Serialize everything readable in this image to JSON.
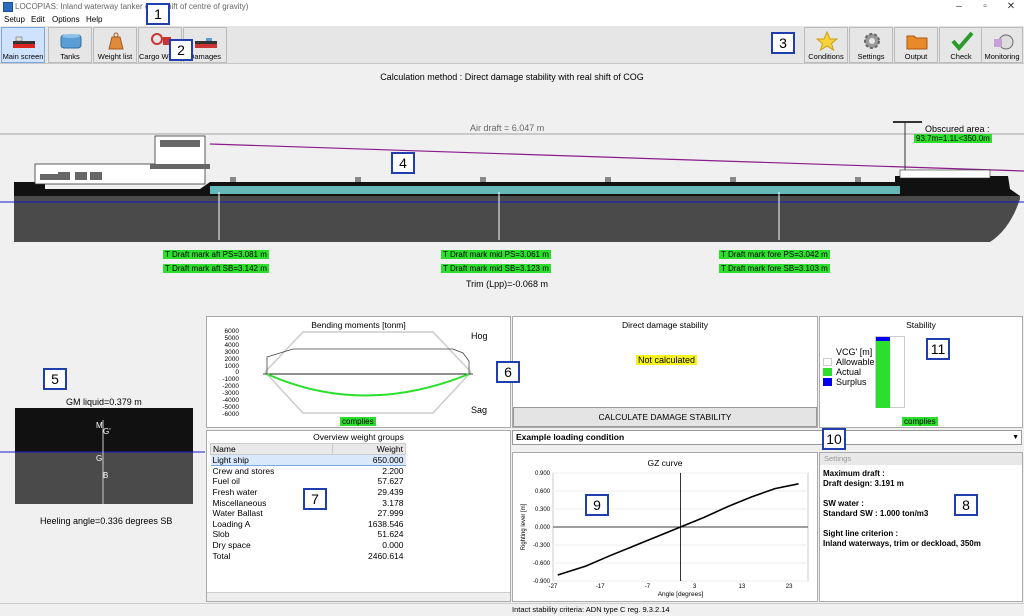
{
  "window": {
    "title": "LOCOPIAS: Inland waterway tanker (real shift of centre of gravity)",
    "minimize": "–",
    "maximize": "▫",
    "close": "✕"
  },
  "menu": [
    "Setup",
    "Edit",
    "Options",
    "Help"
  ],
  "toolbar_left": [
    {
      "label": "Main screen",
      "icon": "ship-icon"
    },
    {
      "label": "Tanks",
      "icon": "tanks-icon"
    },
    {
      "label": "Weight list",
      "icon": "weight-icon"
    },
    {
      "label": "Cargo Weights",
      "icon": "cargo-weights-icon"
    },
    {
      "label": "Damages",
      "icon": "damages-icon"
    }
  ],
  "toolbar_right": [
    {
      "label": "Conditions",
      "icon": "star-icon"
    },
    {
      "label": "Settings",
      "icon": "gear-icon"
    },
    {
      "label": "Output",
      "icon": "folder-icon"
    },
    {
      "label": "Check",
      "icon": "check-icon"
    },
    {
      "label": "Monitoring",
      "icon": "stopwatch-icon"
    }
  ],
  "callouts": [
    "1",
    "2",
    "3",
    "4",
    "5",
    "6",
    "7",
    "8",
    "9",
    "10",
    "11"
  ],
  "profile": {
    "calc_method": "Calculation method : Direct damage stability with real shift of COG",
    "air_draft": "Air draft = 6.047 m",
    "obscured_label": "Obscured area :",
    "obscured_value": "93.7m=1.1L<350.0m",
    "draft_aft_ps": "T Draft mark aft PS=3.081 m",
    "draft_aft_sb": "T Draft mark aft SB=3.142 m",
    "draft_mid_ps": "T Draft mark mid PS=3.061 m",
    "draft_mid_sb": "T Draft mark mid SB=3.123 m",
    "draft_fore_ps": "T Draft mark fore PS=3.042 m",
    "draft_fore_sb": "T Draft mark fore SB=3.103 m",
    "trim": "Trim (Lpp)=-0.068 m"
  },
  "section": {
    "gm": "GM liquid=0.379 m",
    "heel": "Heeling angle=0.336 degrees SB",
    "m_label": "M",
    "g_label": "G",
    "gprime": "G'",
    "b_label": "B"
  },
  "bending": {
    "title": "Bending moments [tonm]",
    "hog": "Hog",
    "sag": "Sag",
    "status": "complies",
    "ticks": [
      "6000",
      "5000",
      "4000",
      "3000",
      "2000",
      "1000",
      "0",
      "-1000",
      "-2000",
      "-3000",
      "-4000",
      "-5000",
      "-6000"
    ]
  },
  "dds": {
    "title": "Direct damage stability",
    "status": "Not calculated",
    "button": "CALCULATE DAMAGE STABILITY"
  },
  "stability": {
    "title": "Stability",
    "vcg": "VCG' [m]",
    "allowable": "Allowable",
    "actual": "Actual",
    "surplus": "Surplus",
    "status": "complies"
  },
  "weights": {
    "title": "Overview weight groups",
    "col_name": "Name",
    "col_weight": "Weight",
    "rows": [
      [
        "Light ship",
        "650.000"
      ],
      [
        "Crew and stores",
        "2.200"
      ],
      [
        "Fuel oil",
        "57.627"
      ],
      [
        "Fresh water",
        "29.439"
      ],
      [
        "Miscellaneous",
        "3.178"
      ],
      [
        "Water Ballast",
        "27.999"
      ],
      [
        "Loading A",
        "1638.546"
      ],
      [
        "Slob",
        "51.624"
      ],
      [
        "Dry space",
        "0.000"
      ],
      [
        "Total",
        "2460.614"
      ]
    ]
  },
  "condition": {
    "selected": "Example loading condition"
  },
  "chart_data": {
    "type": "line",
    "title": "GZ curve",
    "xlabel": "Angle [degrees]",
    "ylabel": "Righting lever [m]",
    "xlim": [
      -27,
      27
    ],
    "ylim": [
      -0.9,
      0.9
    ],
    "x_ticks": [
      "-27",
      "-17",
      "-7",
      "3",
      "13",
      "23"
    ],
    "y_ticks": [
      "0.900",
      "0.600",
      "0.300",
      "0.000",
      "-0.300",
      "-0.600",
      "-0.900"
    ],
    "series": [
      {
        "x": [
          -26,
          -20,
          -15,
          -10,
          -5,
          0,
          5,
          10,
          15,
          20,
          25
        ],
        "values": [
          -0.8,
          -0.65,
          -0.48,
          -0.32,
          -0.16,
          0.0,
          0.16,
          0.34,
          0.5,
          0.64,
          0.72
        ]
      }
    ]
  },
  "settings": {
    "header": "Settings",
    "max_draft": "Maximum draft :",
    "draft_design": "Draft design: 3.191 m",
    "sw_water": "SW water :",
    "standard_sw": "Standard SW : 1.000 ton/m3",
    "sight_line": "Sight line criterion :",
    "sight_value": "Inland waterways, trim or deckload, 350m"
  },
  "status": "Intact stability criteria: ADN type C reg. 9.3.2.14",
  "colors": {
    "accent": "#2ddf2d",
    "callout": "#1f3fae",
    "hull": "#4a4a4a",
    "cargo": "#66b8b8",
    "sight_line": "#8b1a8b",
    "waterline": "#1a1acc"
  }
}
